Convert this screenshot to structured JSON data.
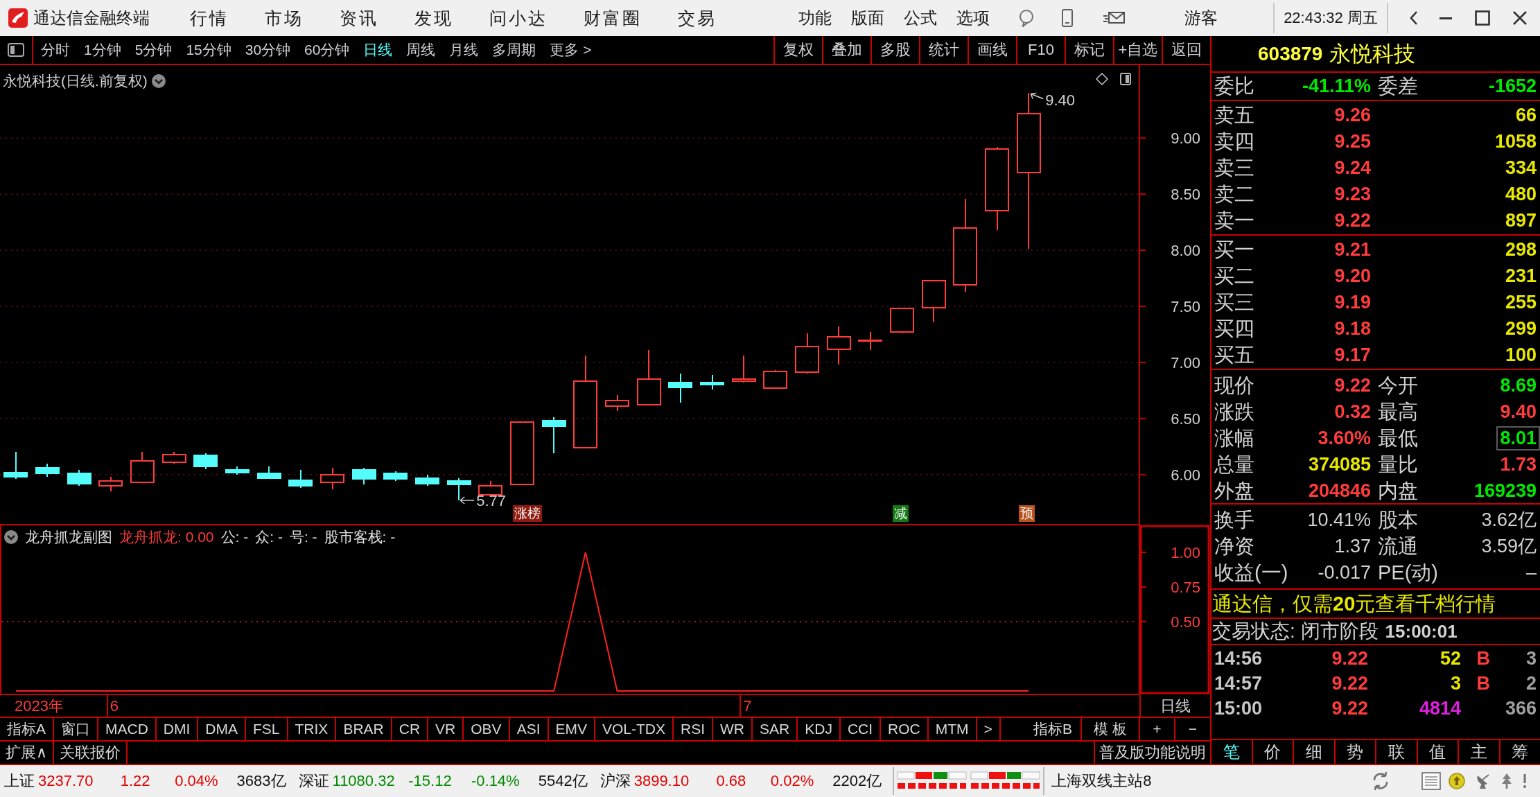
{
  "title_bar": {
    "app_name": "通达信金融终端",
    "menu": [
      "行情",
      "市场",
      "资讯",
      "发现",
      "问小达",
      "财富圈",
      "交易"
    ],
    "tools": [
      "功能",
      "版面",
      "公式",
      "选项"
    ],
    "user": "游客",
    "clock": "22:43:32 周五"
  },
  "period_bar": {
    "periods": [
      {
        "label": "分时",
        "selected": false
      },
      {
        "label": "1分钟",
        "selected": false
      },
      {
        "label": "5分钟",
        "selected": false
      },
      {
        "label": "15分钟",
        "selected": false
      },
      {
        "label": "30分钟",
        "selected": false
      },
      {
        "label": "60分钟",
        "selected": false
      },
      {
        "label": "日线",
        "selected": true
      },
      {
        "label": "周线",
        "selected": false
      },
      {
        "label": "月线",
        "selected": false
      },
      {
        "label": "多周期",
        "selected": false
      },
      {
        "label": "更多 >",
        "selected": false
      }
    ],
    "actions": [
      "复权",
      "叠加",
      "多股",
      "统计",
      "画线",
      "F10",
      "标记",
      "+自选",
      "返回"
    ]
  },
  "main_chart": {
    "title": "永悦科技(日线.前复权)",
    "price_axis": [
      "9.00",
      "8.50",
      "8.00",
      "7.50",
      "7.00",
      "6.50",
      "6.00"
    ],
    "high_label": "9.40",
    "low_label": "5.77",
    "tags": [
      {
        "label": "涨榜",
        "color": "#8e1b10"
      },
      {
        "label": "减",
        "color": "#137a13"
      },
      {
        "label": "预",
        "color": "#b9521a"
      }
    ]
  },
  "sub_chart": {
    "readouts": [
      {
        "text": "龙舟抓龙: 0.00",
        "color": "#ff3c3c"
      },
      {
        "text": "公: -",
        "color": "#e0e0e0"
      },
      {
        "text": "众: -",
        "color": "#e0e0e0"
      },
      {
        "text": "号: -",
        "color": "#e0e0e0"
      },
      {
        "text": "股市客栈: -",
        "color": "#e0e0e0"
      }
    ],
    "chart_data": {
      "type": "line",
      "title": "龙舟抓龙副图",
      "ylim": [
        -0.025,
        1.2
      ],
      "yticks": [
        {
          "value": 0.5,
          "label": "0.50"
        },
        {
          "value": 0.75,
          "label": "0.75"
        },
        {
          "value": 1.0,
          "label": "1.00"
        }
      ],
      "ref_lines": [
        {
          "axis": "y",
          "value": 0.5
        }
      ],
      "series": [
        {
          "color": "#ff2020",
          "values": [
            0,
            0,
            0,
            0,
            0,
            0,
            0,
            0,
            0,
            0,
            0,
            0,
            0,
            0,
            0,
            0,
            0,
            0,
            1,
            0,
            0,
            0,
            0,
            0,
            0,
            0,
            0,
            0,
            0,
            0,
            0,
            0,
            0,
            null,
            null,
            null
          ]
        }
      ]
    }
  },
  "date_axis": {
    "year": "2023年",
    "months": [
      "6",
      "7"
    ],
    "period": "日线"
  },
  "indicator_bar": {
    "tabs": [
      "指标A",
      "窗口",
      "MACD",
      "DMI",
      "DMA",
      "FSL",
      "TRIX",
      "BRAR",
      "CR",
      "VR",
      "OBV",
      "ASI",
      "EMV",
      "VOL-TDX",
      "RSI",
      "WR",
      "SAR",
      "KDJ",
      "CCI",
      "ROC",
      "MTM",
      ">"
    ],
    "right_tabs": [
      "指标B",
      "模 板",
      "+",
      "−"
    ]
  },
  "extension_bar": {
    "tabs": [
      "扩展∧",
      "关联报价"
    ],
    "help": "普及版功能说明"
  },
  "quote_panel": {
    "code": "603879",
    "name": "永悦科技",
    "ratio": [
      {
        "label": "委比",
        "value": "-41.11%",
        "color": "#00e800"
      },
      {
        "label": "委差",
        "value": "-1652",
        "color": "#00e800"
      }
    ],
    "asks": [
      {
        "label": "卖五",
        "price": "9.26",
        "volume": "66"
      },
      {
        "label": "卖四",
        "price": "9.25",
        "volume": "1058"
      },
      {
        "label": "卖三",
        "price": "9.24",
        "volume": "334"
      },
      {
        "label": "卖二",
        "price": "9.23",
        "volume": "480"
      },
      {
        "label": "卖一",
        "price": "9.22",
        "volume": "897"
      }
    ],
    "bids": [
      {
        "label": "买一",
        "price": "9.21",
        "volume": "298"
      },
      {
        "label": "买二",
        "price": "9.20",
        "volume": "231"
      },
      {
        "label": "买三",
        "price": "9.19",
        "volume": "255"
      },
      {
        "label": "买四",
        "price": "9.18",
        "volume": "299"
      },
      {
        "label": "买五",
        "price": "9.17",
        "volume": "100"
      }
    ],
    "stats": [
      {
        "label": "现价",
        "value": "9.22",
        "color": "#ff3c3c",
        "highlighted": false
      },
      {
        "label": "今开",
        "value": "8.69",
        "color": "#00e800",
        "highlighted": false
      },
      {
        "label": "涨跌",
        "value": "0.32",
        "color": "#ff3c3c",
        "highlighted": false
      },
      {
        "label": "最高",
        "value": "9.40",
        "color": "#ff3c3c",
        "highlighted": false
      },
      {
        "label": "涨幅",
        "value": "3.60%",
        "color": "#ff3c3c",
        "highlighted": false
      },
      {
        "label": "最低",
        "value": "8.01",
        "color": "#00e800",
        "highlighted": true
      },
      {
        "label": "总量",
        "value": "374085",
        "color": "#e8e800",
        "highlighted": false
      },
      {
        "label": "量比",
        "value": "1.73",
        "color": "#ff3c3c",
        "highlighted": false
      },
      {
        "label": "外盘",
        "value": "204846",
        "color": "#ff3c3c",
        "highlighted": false
      },
      {
        "label": "内盘",
        "value": "169239",
        "color": "#00e800",
        "highlighted": false
      }
    ],
    "fundamentals": [
      {
        "label": "换手",
        "value": "10.41%"
      },
      {
        "label": "股本",
        "value": "3.62亿"
      },
      {
        "label": "净资",
        "value": "1.37"
      },
      {
        "label": "流通",
        "value": "3.59亿"
      },
      {
        "label": "收益(一)",
        "value": "-0.017"
      },
      {
        "label": "PE(动)",
        "value": "–"
      }
    ],
    "promo": "通达信，仅需**20**元查看千档行情",
    "trade_status": {
      "text": "交易状态: 闭市阶段",
      "time": "15:00:01"
    },
    "ticks": [
      {
        "time": "14:56",
        "price": "9.22",
        "volume": "52",
        "color": "#e8e800",
        "side": "B",
        "count": "3"
      },
      {
        "time": "14:57",
        "price": "9.22",
        "volume": "3",
        "color": "#e8e800",
        "side": "B",
        "count": "2"
      },
      {
        "time": "15:00",
        "price": "9.22",
        "volume": "4814",
        "color": "#e020e0",
        "count": "366"
      }
    ],
    "tabs": [
      {
        "label": "笔",
        "selected": true
      },
      {
        "label": "价",
        "selected": false
      },
      {
        "label": "细",
        "selected": false
      },
      {
        "label": "势",
        "selected": false
      },
      {
        "label": "联",
        "selected": false
      },
      {
        "label": "值",
        "selected": false
      },
      {
        "label": "主",
        "selected": false
      },
      {
        "label": "筹",
        "selected": false
      }
    ]
  },
  "status_bar": {
    "indices": [
      {
        "name": "上证",
        "value": "3237.70",
        "change": "1.22",
        "percent": "0.04%",
        "amount": "3683亿",
        "color": "#e00000"
      },
      {
        "name": "深证",
        "value": "11080.32",
        "change": "-15.12",
        "percent": "-0.14%",
        "amount": "5542亿",
        "color": "#008a00"
      },
      {
        "name": "沪深",
        "value": "3899.10",
        "change": "0.68",
        "percent": "0.02%",
        "amount": "2202亿",
        "color": "#e00000"
      }
    ],
    "server": "上海双线主站8"
  }
}
